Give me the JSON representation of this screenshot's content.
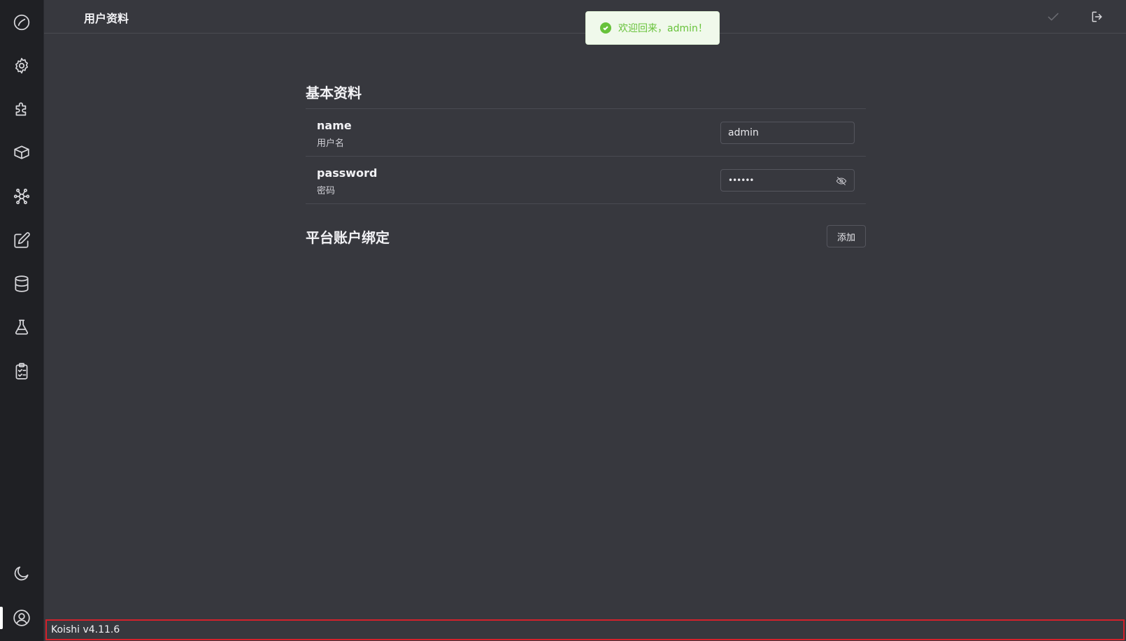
{
  "header": {
    "title": "用户资料",
    "save_icon": "check-icon",
    "logout_icon": "logout-icon"
  },
  "sidebar": {
    "items": [
      {
        "icon": "dashboard-icon"
      },
      {
        "icon": "gear-icon"
      },
      {
        "icon": "puzzle-icon"
      },
      {
        "icon": "package-icon"
      },
      {
        "icon": "network-icon"
      },
      {
        "icon": "edit-icon"
      },
      {
        "icon": "database-icon"
      },
      {
        "icon": "flask-icon"
      },
      {
        "icon": "clipboard-icon"
      }
    ],
    "bottom": [
      {
        "icon": "moon-icon"
      },
      {
        "icon": "user-circle-icon",
        "active": true
      }
    ]
  },
  "toast": {
    "message": "欢迎回来，admin！",
    "type": "success"
  },
  "profile": {
    "section_title": "基本资料",
    "fields": [
      {
        "key": "name",
        "description": "用户名",
        "value": "admin"
      },
      {
        "key": "password",
        "description": "密码",
        "value": "••••••"
      }
    ]
  },
  "bindings": {
    "section_title": "平台账户绑定",
    "add_label": "添加"
  },
  "status": {
    "version": "Koishi v4.11.6"
  },
  "colors": {
    "background": "#37383e",
    "sidebar": "#1f2024",
    "toast_bg": "#f0f9eb",
    "success": "#67c23a",
    "highlight_border": "#d4212b"
  }
}
